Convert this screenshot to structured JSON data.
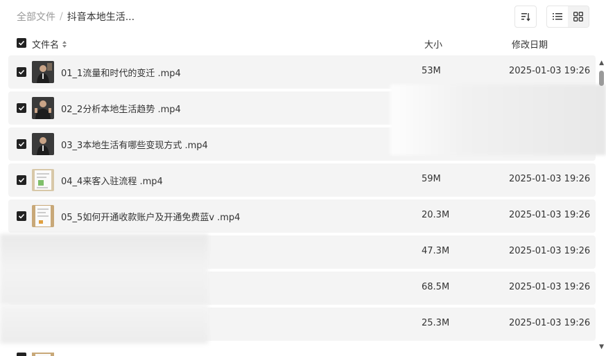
{
  "breadcrumb": {
    "root": "全部文件",
    "separator": "/",
    "current": "抖音本地生活..."
  },
  "table": {
    "headers": {
      "name": "文件名",
      "size": "大小",
      "date": "修改日期"
    },
    "rows": [
      {
        "name": "01_1流量和时代的变迁 .mp4",
        "size": "53M",
        "date": "2025-01-03 19:26",
        "thumb": "person"
      },
      {
        "name": "02_2分析本地生活趋势 .mp4",
        "size": "",
        "date": "",
        "thumb": "person"
      },
      {
        "name": "03_3本地生活有哪些变现方式 .mp4",
        "size": "",
        "date": "",
        "thumb": "person"
      },
      {
        "name": "04_4来客入驻流程 .mp4",
        "size": "59M",
        "date": "2025-01-03 19:26",
        "thumb": "phone"
      },
      {
        "name": "05_5如何开通收款账户及开通免费蓝v .mp4",
        "size": "20.3M",
        "date": "2025-01-03 19:26",
        "thumb": "phone"
      },
      {
        "name": "",
        "size": "47.3M",
        "date": "2025-01-03 19:26",
        "thumb": ""
      },
      {
        "name": "",
        "size": "68.5M",
        "date": "2025-01-03 19:26",
        "thumb": ""
      },
      {
        "name": "",
        "size": "25.3M",
        "date": "2025-01-03 19:26",
        "thumb": ""
      }
    ]
  }
}
